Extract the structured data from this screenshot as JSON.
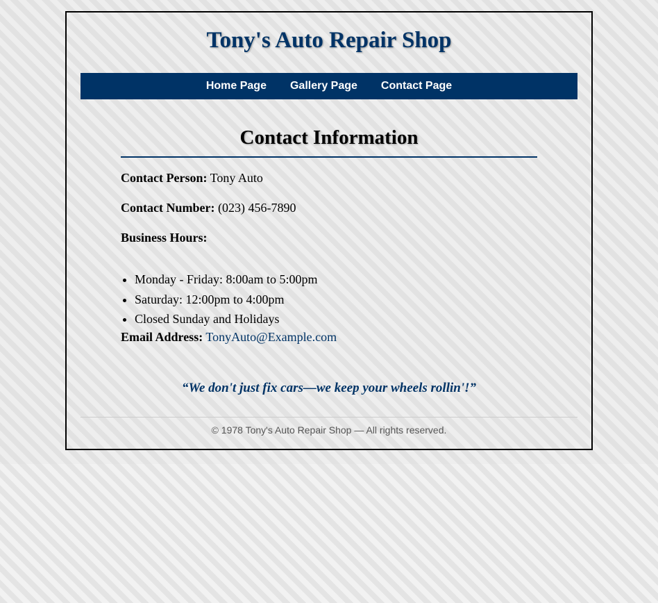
{
  "site": {
    "title": "Tony's Auto Repair Shop"
  },
  "nav": {
    "items": [
      {
        "label": "Home Page"
      },
      {
        "label": "Gallery Page"
      },
      {
        "label": "Contact Page"
      }
    ]
  },
  "contact": {
    "heading": "Contact Information",
    "person_label": "Contact Person:",
    "person_value": "Tony Auto",
    "number_label": "Contact Number:",
    "number_value": "(023) 456-7890",
    "hours_label": "Business Hours:",
    "hours": [
      "Monday - Friday: 8:00am to 5:00pm",
      "Saturday: 12:00pm to 4:00pm",
      "Closed Sunday and Holidays"
    ],
    "email_label": "Email Address:",
    "email_value": "TonyAuto@Example.com",
    "slogan": "“We don't just fix cars—we keep your wheels rollin'!”"
  },
  "footer": {
    "text": "© 1978 Tony's Auto Repair Shop — All rights reserved."
  },
  "colors": {
    "brand": "#003366",
    "footer_text": "#555555",
    "frame_border": "#000000"
  }
}
